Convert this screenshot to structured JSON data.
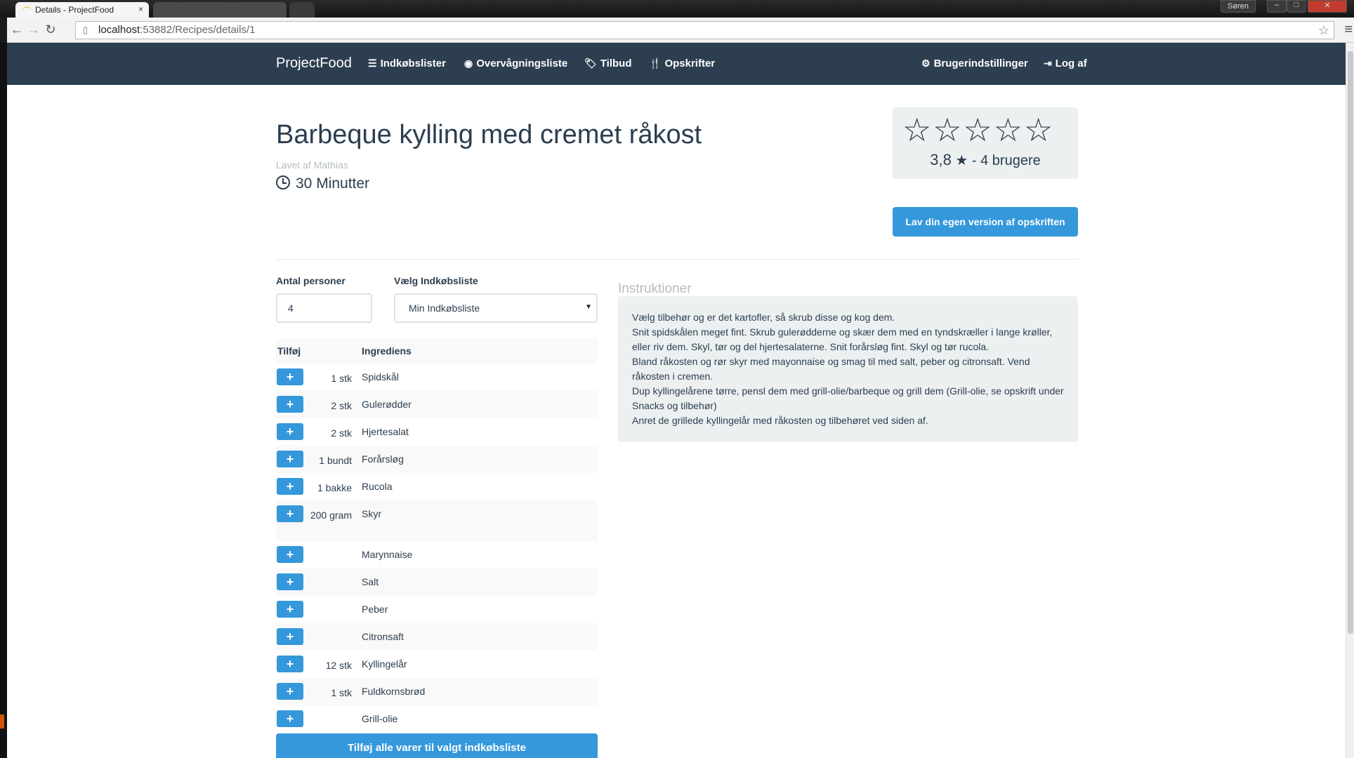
{
  "browser": {
    "tab_title": "Details - ProjectFood",
    "tab_close": "×",
    "user_badge": "Søren",
    "url_host": "localhost",
    "url_path": ":53882/Recipes/details/1"
  },
  "navbar": {
    "brand": "ProjectFood",
    "links": [
      {
        "icon": "list-icon",
        "glyph": "☰",
        "label": "Indkøbslister"
      },
      {
        "icon": "eye-icon",
        "glyph": "◉",
        "label": "Overvågningsliste"
      },
      {
        "icon": "tag-icon",
        "glyph": "🏷",
        "label": "Tilbud"
      },
      {
        "icon": "cutlery-icon",
        "glyph": "🍴",
        "label": "Opskrifter"
      },
      {
        "icon": "gear-icon",
        "glyph": "⚙",
        "label": "Brugerindstillinger"
      },
      {
        "icon": "logout-icon",
        "glyph": "⇥",
        "label": "Log af"
      }
    ]
  },
  "recipe": {
    "title": "Barbeque kylling med cremet råkost",
    "author": "Lavet af Mathias",
    "time": "30 Minutter"
  },
  "rating": {
    "stars": "☆☆☆☆☆",
    "average": "3,8",
    "star_glyph": "★",
    "users": "- 4 brugere",
    "value": 3.8,
    "max": 5
  },
  "buttons": {
    "own_version": "Lav din egen version af opskriften",
    "add_all": "Tilføj alle varer til valgt indkøbsliste"
  },
  "form": {
    "persons_label": "Antal personer",
    "persons_value": "4",
    "list_label": "Vælg Indkøbsliste",
    "list_value": "Min Indkøbsliste"
  },
  "ingredients": {
    "col_add": "Tilføj",
    "col_name": "Ingrediens",
    "rows": [
      {
        "amount": "1 stk",
        "name": "Spidskål"
      },
      {
        "amount": "2 stk",
        "name": "Gulerødder"
      },
      {
        "amount": "2 stk",
        "name": "Hjertesalat"
      },
      {
        "amount": "1 bundt",
        "name": "Forårsløg"
      },
      {
        "amount": "1 bakke",
        "name": "Rucola"
      },
      {
        "amount": "200 gram",
        "name": "Skyr"
      },
      {
        "amount": "",
        "name": "Marynnaise"
      },
      {
        "amount": "",
        "name": "Salt"
      },
      {
        "amount": "",
        "name": "Peber"
      },
      {
        "amount": "",
        "name": "Citronsaft"
      },
      {
        "amount": "12 stk",
        "name": "Kyllingelår"
      },
      {
        "amount": "1 stk",
        "name": "Fuldkornsbrød"
      },
      {
        "amount": "",
        "name": "Grill-olie"
      }
    ]
  },
  "instructions": {
    "title": "Instruktioner",
    "lines": [
      "Vælg tilbehør og er det kartofler, så skrub disse og kog dem.",
      "Snit spidskålen meget fint. Skrub gulerødderne og skær dem med en tyndskræller i lange krøller, eller riv dem. Skyl, tør og del hjertesalaterne. Snit forårsløg fint. Skyl og tør rucola.",
      "Bland råkosten og rør skyr med mayonnaise og smag til med salt, peber og citronsaft. Vend råkosten i cremen.",
      "Dup kyllingelårene tørre, pensl dem med grill-olie/barbeque og grill dem (Grill-olie, se opskrift under Snacks og tilbehør)",
      "Anret de grillede kyllingelår med råkosten og tilbehøret ved siden af."
    ]
  }
}
